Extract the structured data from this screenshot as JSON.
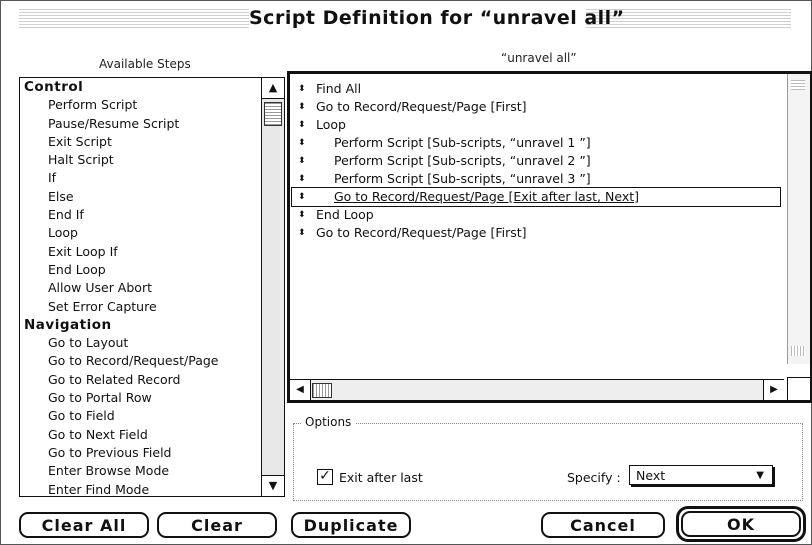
{
  "window": {
    "title": "Script Definition for “unravel all”"
  },
  "available_steps": {
    "label": "Available Steps",
    "items": [
      {
        "text": "Control",
        "kind": "cat"
      },
      {
        "text": "Perform Script",
        "kind": "item"
      },
      {
        "text": "Pause/Resume Script",
        "kind": "item"
      },
      {
        "text": "Exit Script",
        "kind": "item"
      },
      {
        "text": "Halt Script",
        "kind": "item"
      },
      {
        "text": "If",
        "kind": "item"
      },
      {
        "text": "Else",
        "kind": "item"
      },
      {
        "text": "End If",
        "kind": "item"
      },
      {
        "text": "Loop",
        "kind": "item"
      },
      {
        "text": "Exit Loop If",
        "kind": "item"
      },
      {
        "text": "End Loop",
        "kind": "item"
      },
      {
        "text": "Allow User Abort",
        "kind": "item"
      },
      {
        "text": "Set Error Capture",
        "kind": "item"
      },
      {
        "text": "Navigation",
        "kind": "cat"
      },
      {
        "text": "Go to Layout",
        "kind": "item"
      },
      {
        "text": "Go to Record/Request/Page",
        "kind": "item"
      },
      {
        "text": "Go to Related Record",
        "kind": "item"
      },
      {
        "text": "Go to Portal Row",
        "kind": "item"
      },
      {
        "text": "Go to Field",
        "kind": "item"
      },
      {
        "text": "Go to Next Field",
        "kind": "item"
      },
      {
        "text": "Go to Previous Field",
        "kind": "item"
      },
      {
        "text": "Enter Browse Mode",
        "kind": "item"
      },
      {
        "text": "Enter Find Mode",
        "kind": "item"
      }
    ]
  },
  "script": {
    "label": "“unravel all”",
    "lines": [
      {
        "text": "Find All",
        "indent": 0,
        "selected": false
      },
      {
        "text": "Go to Record/Request/Page [First]",
        "indent": 0,
        "selected": false
      },
      {
        "text": "Loop",
        "indent": 0,
        "selected": false
      },
      {
        "text": "Perform Script [Sub-scripts, “unravel 1 ”]",
        "indent": 1,
        "selected": false
      },
      {
        "text": "Perform Script [Sub-scripts, “unravel 2 ”]",
        "indent": 1,
        "selected": false
      },
      {
        "text": "Perform Script [Sub-scripts, “unravel 3 ”]",
        "indent": 1,
        "selected": false
      },
      {
        "text": "Go to Record/Request/Page [Exit after last, Next]",
        "indent": 1,
        "selected": true
      },
      {
        "text": "End Loop",
        "indent": 0,
        "selected": false
      },
      {
        "text": "Go to Record/Request/Page [First]",
        "indent": 0,
        "selected": false
      }
    ]
  },
  "options": {
    "label": "Options",
    "exit_after_last": {
      "label": "Exit after last",
      "checked": true,
      "mark": "✓"
    },
    "specify": {
      "label": "Specify :",
      "value": "Next"
    }
  },
  "buttons": {
    "clear_all": "Clear All",
    "clear": "Clear",
    "duplicate": "Duplicate",
    "cancel": "Cancel",
    "ok": "OK"
  },
  "icons": {
    "up": "▲",
    "down": "▼",
    "left": "◀",
    "right": "▶",
    "handle": "⬍"
  }
}
